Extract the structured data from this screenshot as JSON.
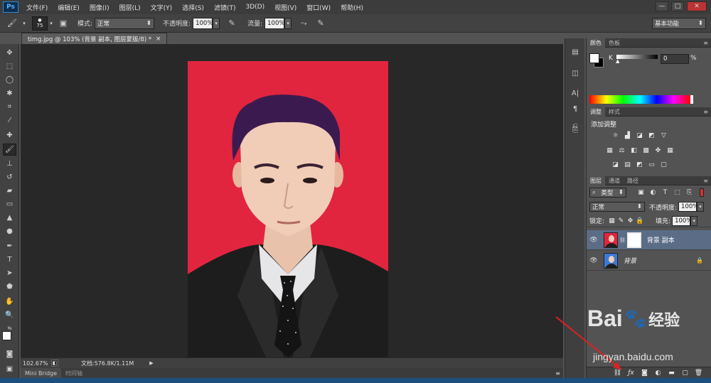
{
  "menu": {
    "logo": "Ps",
    "items": [
      "文件(F)",
      "编辑(E)",
      "图像(I)",
      "图层(L)",
      "文字(Y)",
      "选择(S)",
      "滤镜(T)",
      "3D(D)",
      "视图(V)",
      "窗口(W)",
      "帮助(H)"
    ],
    "win_min": "—",
    "win_max": "□",
    "win_close": "✕"
  },
  "options": {
    "brush_size": "75",
    "mode_label": "模式:",
    "mode_value": "正常",
    "opacity_label": "不透明度:",
    "opacity_value": "100%",
    "flow_label": "流量:",
    "flow_value": "100%",
    "workspace": "基本功能"
  },
  "document": {
    "tab_title": "timg.jpg @ 103% (背景 副本, 图层蒙版/8) *",
    "tab_close": "×",
    "zoom": "102.67%",
    "doc_size": "文档:576.8K/1.11M"
  },
  "bottom_tabs": [
    "Mini Bridge",
    "时间轴"
  ],
  "color_panel": {
    "tabs": [
      "颜色",
      "色板"
    ],
    "channel_label": "K",
    "channel_value": "0",
    "unit": "%"
  },
  "adjust_panel": {
    "tabs": [
      "调整",
      "样式"
    ],
    "title": "添加调整"
  },
  "layers_panel": {
    "tabs": [
      "图层",
      "通道",
      "路径"
    ],
    "filter_label": "类型",
    "blend_mode": "正常",
    "opacity_label": "不透明度:",
    "opacity_value": "100%",
    "lock_label": "锁定:",
    "fill_label": "填充:",
    "fill_value": "100%",
    "layers": [
      {
        "name": "背景 副本",
        "selected": true,
        "has_mask": true
      },
      {
        "name": "背景",
        "selected": false,
        "locked": true
      }
    ]
  },
  "watermark": {
    "brand": "Bai",
    "brand_suffix": "经验",
    "url": "jingyan.baidu.com"
  },
  "colors": {
    "red_background": "#e2253f",
    "selected_layer": "#5b6d86",
    "arrow": "#e02020"
  }
}
